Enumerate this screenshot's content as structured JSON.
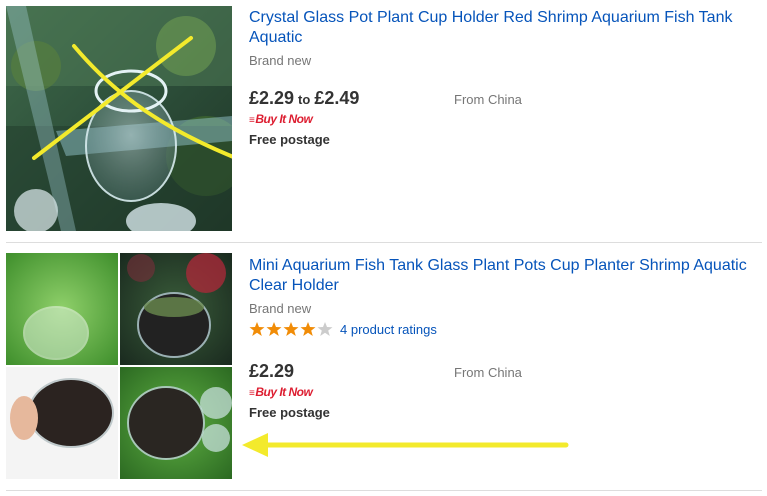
{
  "listings": [
    {
      "title": "Crystal Glass Pot Plant Cup Holder Red Shrimp Aquarium Fish Tank Aquatic",
      "condition": "Brand new",
      "price_low": "£2.29",
      "price_sep": "to",
      "price_high": "£2.49",
      "buy_it_now": "Buy It Now",
      "shipping": "Free postage",
      "origin": "From China",
      "image_icon": "glass-cup-photo-icon",
      "annotation_icon": "yellow-cross-icon"
    },
    {
      "title": "Mini Aquarium Fish Tank Glass Plant Pots Cup Planter Shrimp Aquatic Clear Holder",
      "condition": "Brand new",
      "rating": 4,
      "rating_max": 5,
      "ratings_text": "4 product ratings",
      "price": "£2.29",
      "buy_it_now": "Buy It Now",
      "shipping": "Free postage",
      "origin": "From China",
      "image_icon": "plant-pot-collage-icon",
      "annotation_icon": "yellow-arrow-icon"
    }
  ],
  "colors": {
    "link": "#0654ba",
    "star_filled": "#f18c07",
    "star_empty": "#cccccc",
    "bin_red": "#dd1e31",
    "annotation": "#f3ea2c"
  }
}
